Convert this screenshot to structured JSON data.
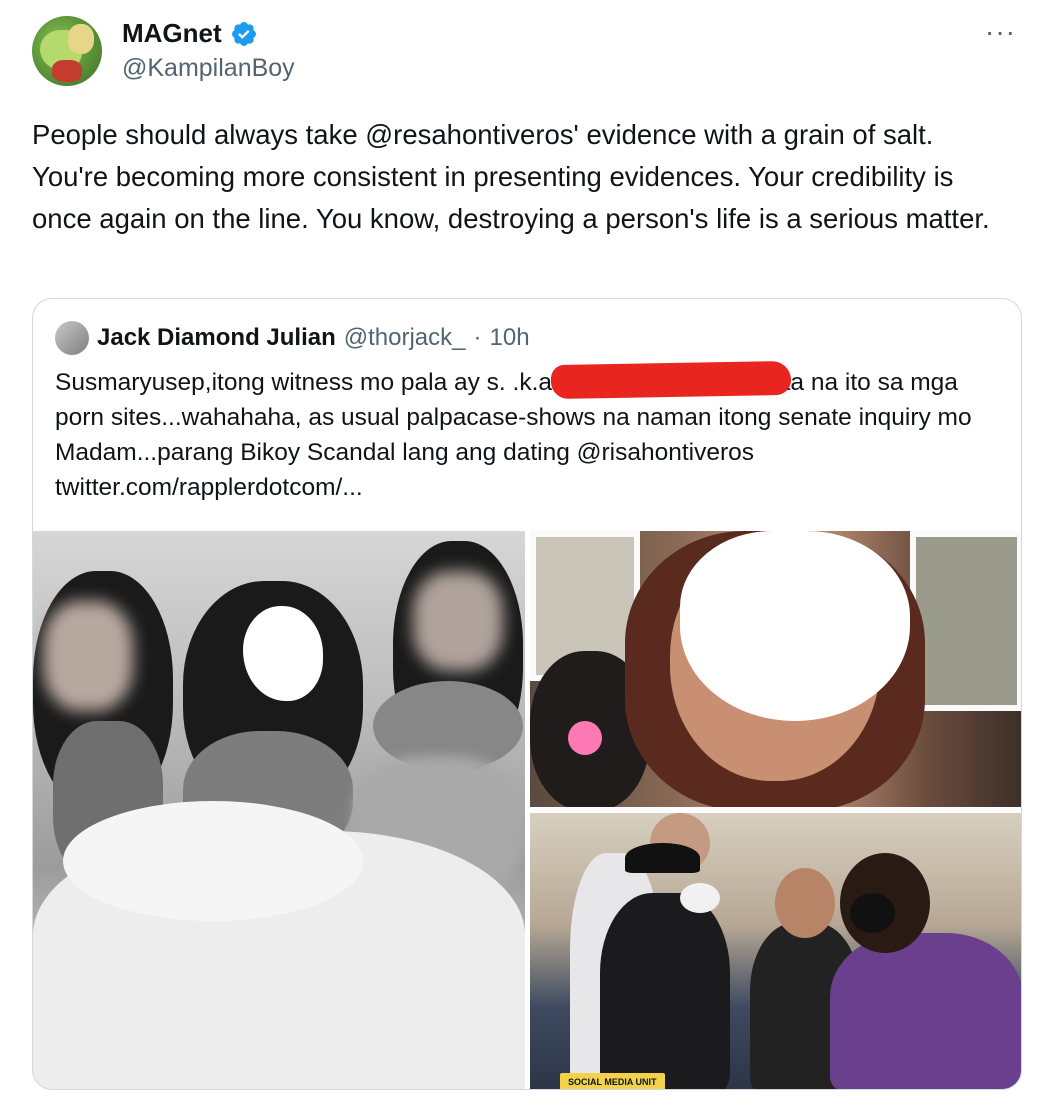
{
  "tweet": {
    "display_name": "MAGnet",
    "handle": "@KampilanBoy",
    "more_label": "···",
    "text": "People should always take @resahontiveros' evidence with a grain of salt. You're becoming more consistent in presenting evidences. Your credibility is once again on the line. You know, destroying a person's life is a serious matter."
  },
  "quote": {
    "display_name": "Jack Diamond Julian",
    "handle": "@thorjack_",
    "separator": "·",
    "time": "10h",
    "text": "Susmaryusep,itong witness mo pala ay s.                            .k.a Amanda parang nakita na ito sa mga porn sites...wahahaha, as usual palpacase-shows na naman itong senate inquiry mo Madam...parang  Bikoy Scandal lang ang dating @risahontiveros  twitter.com/rapplerdotcom/..."
  },
  "media": {
    "watermark_text": "SOCIAL MEDIA UNIT"
  },
  "colors": {
    "verified": "#1d9bf0",
    "redaction": "#e8251e",
    "secondary_text": "#536471"
  }
}
